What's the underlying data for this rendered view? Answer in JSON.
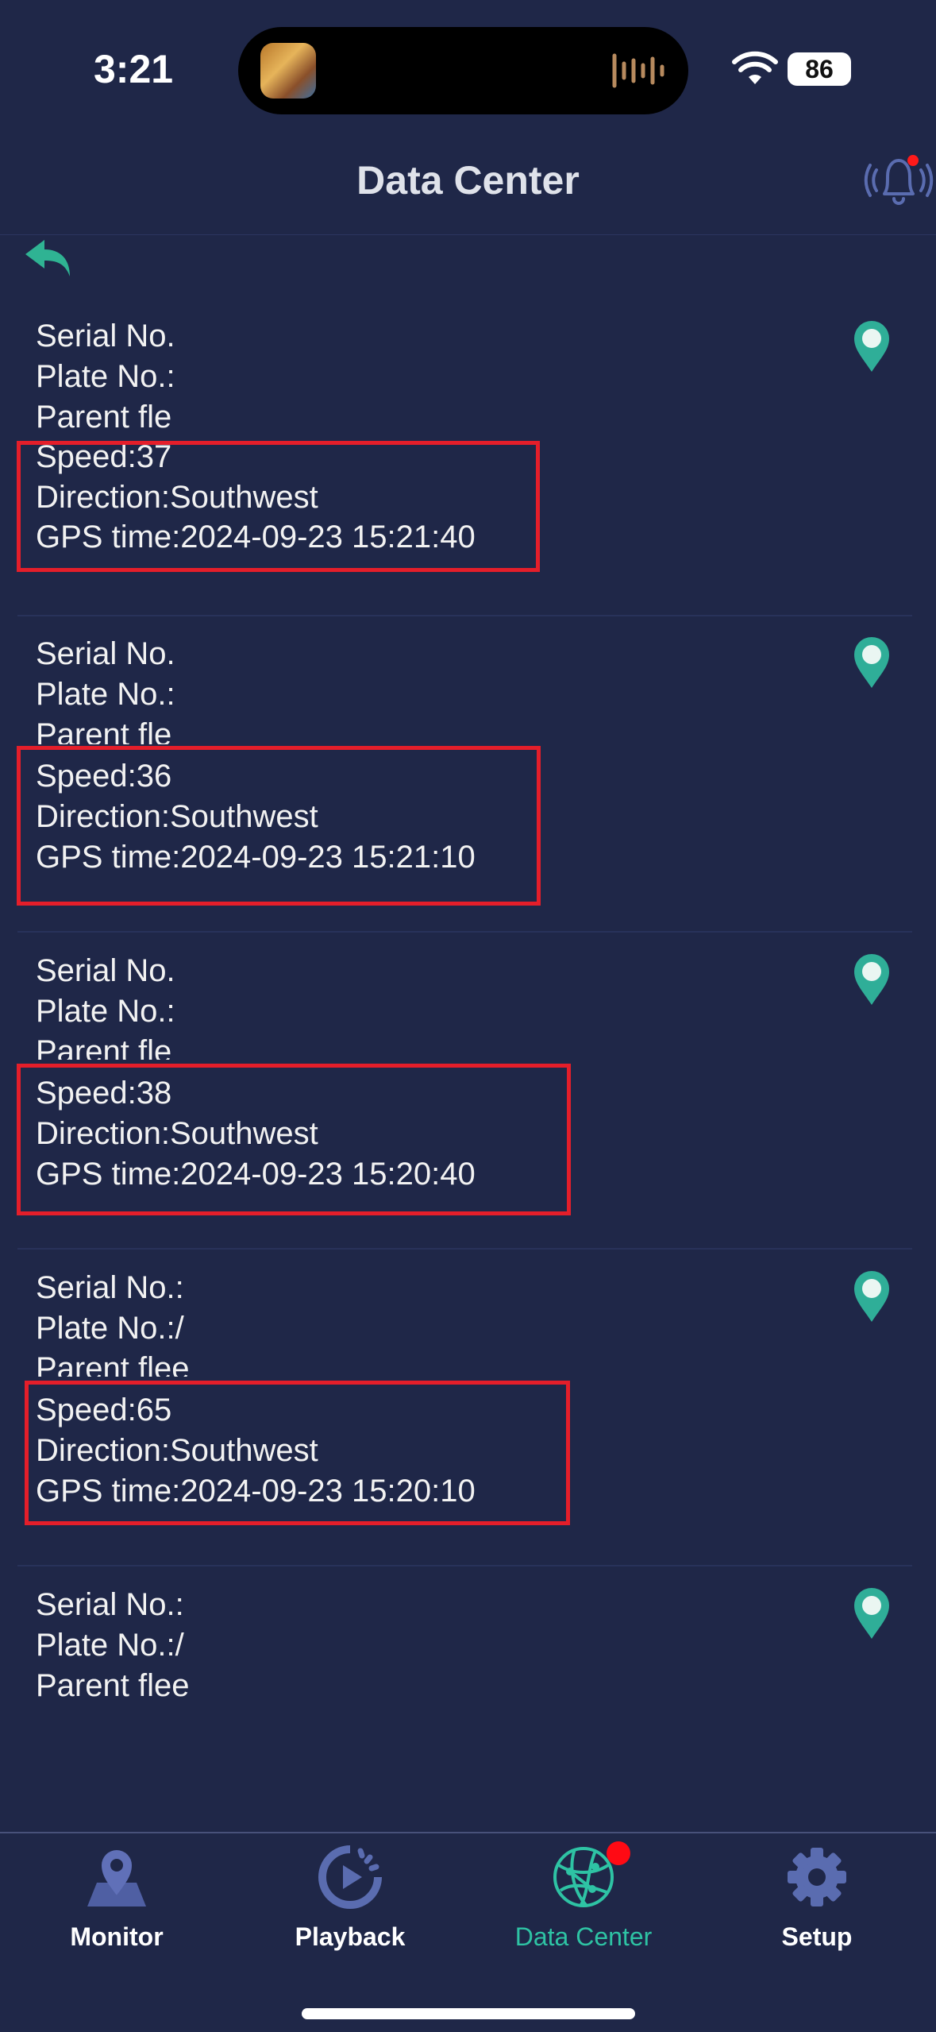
{
  "status": {
    "time": "3:21",
    "battery": "86"
  },
  "header": {
    "title": "Data Center"
  },
  "records": [
    {
      "serial": "Serial No.",
      "plate": "Plate No.:",
      "parent": "Parent fle",
      "speed": "Speed:37",
      "direction": "Direction:Southwest",
      "gps_time": "GPS time:2024-09-23 15:21:40"
    },
    {
      "serial": "Serial No.",
      "plate": "Plate No.:",
      "parent": "Parent fle",
      "speed": "Speed:36",
      "direction": "Direction:Southwest",
      "gps_time": "GPS time:2024-09-23 15:21:10"
    },
    {
      "serial": "Serial No.",
      "plate": "Plate No.:",
      "parent": "Parent fle",
      "speed": "Speed:38",
      "direction": "Direction:Southwest",
      "gps_time": "GPS time:2024-09-23 15:20:40"
    },
    {
      "serial": "Serial No.:",
      "plate": "Plate No.:/",
      "parent": "Parent flee",
      "speed": "Speed:65",
      "direction": "Direction:Southwest",
      "gps_time": "GPS time:2024-09-23 15:20:10"
    },
    {
      "serial": "Serial No.:",
      "plate": "Plate No.:/",
      "parent": "Parent flee"
    }
  ],
  "tabs": [
    {
      "label": "Monitor",
      "icon": "map-pin-icon"
    },
    {
      "label": "Playback",
      "icon": "playback-icon"
    },
    {
      "label": "Data Center",
      "icon": "globe-network-icon",
      "active": true
    },
    {
      "label": "Setup",
      "icon": "gear-icon"
    }
  ],
  "colors": {
    "background": "#1f2748",
    "accent": "#2ec3a4",
    "highlight": "#e41e2a",
    "icon": "#5a6cb0"
  }
}
